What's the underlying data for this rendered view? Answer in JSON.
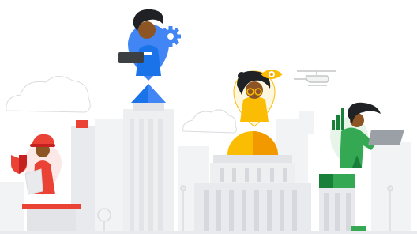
{
  "scene": {
    "description_hidden": "",
    "colors": {
      "building_light": "#eeeff1",
      "building_mid": "#e2e4e7",
      "building_dark": "#d5d8dc",
      "outline": "#dadce0",
      "google_blue": "#4285f4",
      "blue_dark": "#1a73e8",
      "google_red": "#ea4335",
      "red_dark": "#c5221f",
      "google_yellow": "#fbbc04",
      "yellow_dark": "#f29900",
      "google_green": "#34a853",
      "green_dark": "#188038",
      "skin": "#8d5524",
      "hair": "#202124"
    },
    "icons": [
      "gear-icon",
      "eye-icon",
      "shield-icon",
      "bar-chart-icon",
      "helicopter-icon",
      "laptop-icon",
      "tablet-icon"
    ],
    "figures": [
      {
        "role": "blue-pin-person-laptop"
      },
      {
        "role": "red-pin-firefighter"
      },
      {
        "role": "yellow-pin-person-glasses"
      },
      {
        "role": "green-pin-person-tablet"
      }
    ]
  }
}
